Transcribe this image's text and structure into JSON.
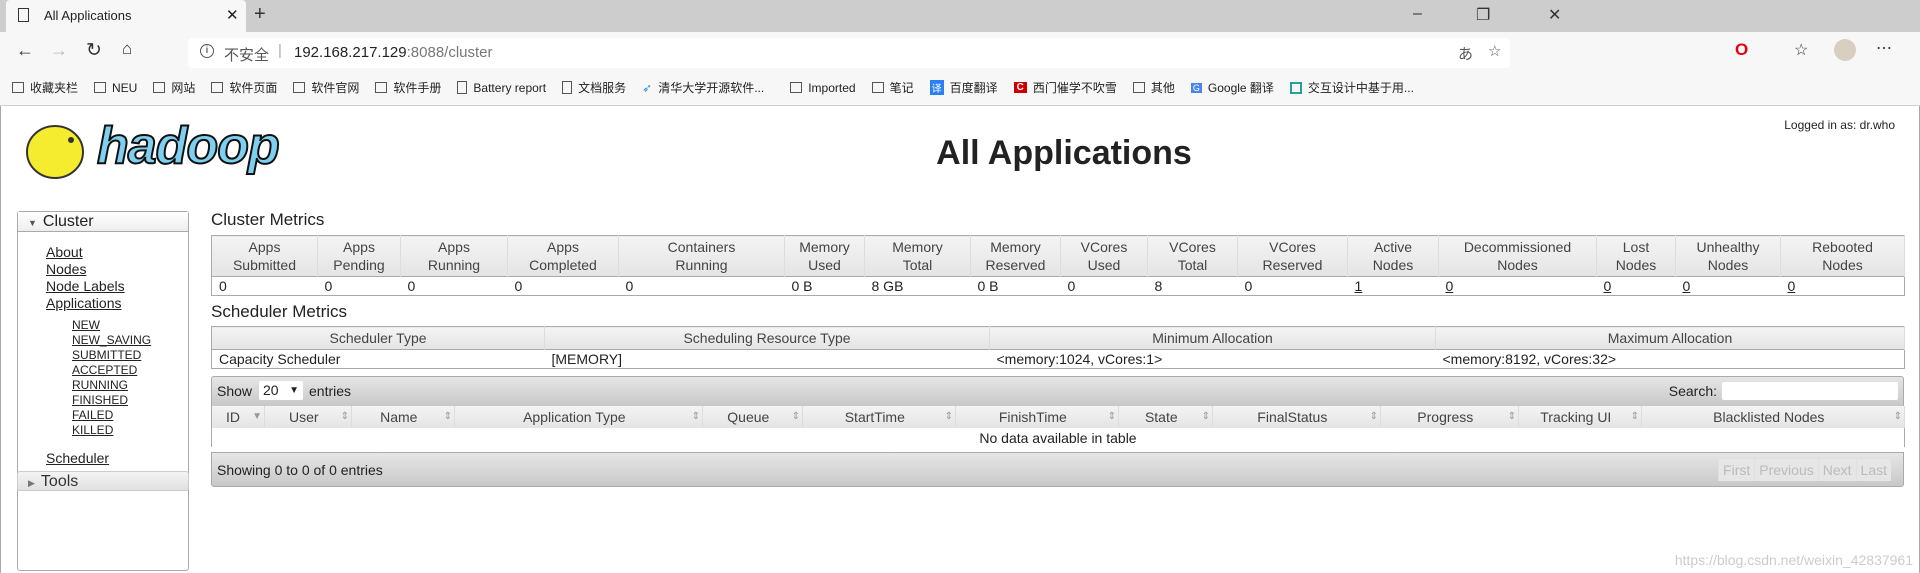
{
  "browser": {
    "tab_title": "All Applications",
    "security_label": "不安全",
    "url_host": "192.168.217.129",
    "url_rest": ":8088/cluster",
    "bookmarks": [
      "收藏夹栏",
      "NEU",
      "网站",
      "软件页面",
      "软件官网",
      "软件手册",
      "Battery report",
      "文档服务",
      "清华大学开源软件...",
      "Imported",
      "笔记",
      "百度翻译",
      "西门催学不吹雪",
      "其他",
      "Google 翻译",
      "交互设计中基于用..."
    ],
    "accent": "#e60012"
  },
  "header": {
    "logo_text": "hadoop",
    "title": "All Applications",
    "logged_in": "Logged in as: dr.who"
  },
  "sidebar": {
    "cluster_label": "Cluster",
    "links": [
      "About",
      "Nodes",
      "Node Labels",
      "Applications"
    ],
    "states": [
      "NEW",
      "NEW_SAVING",
      "SUBMITTED",
      "ACCEPTED",
      "RUNNING",
      "FINISHED",
      "FAILED",
      "KILLED"
    ],
    "scheduler": "Scheduler",
    "tools_label": "Tools"
  },
  "cluster_metrics": {
    "heading": "Cluster Metrics",
    "columns": [
      [
        "Apps",
        "Submitted"
      ],
      [
        "Apps",
        "Pending"
      ],
      [
        "Apps",
        "Running"
      ],
      [
        "Apps",
        "Completed"
      ],
      [
        "Containers",
        "Running"
      ],
      [
        "Memory",
        "Used"
      ],
      [
        "Memory",
        "Total"
      ],
      [
        "Memory",
        "Reserved"
      ],
      [
        "VCores",
        "Used"
      ],
      [
        "VCores",
        "Total"
      ],
      [
        "VCores",
        "Reserved"
      ],
      [
        "Active",
        "Nodes"
      ],
      [
        "Decommissioned",
        "Nodes"
      ],
      [
        "Lost",
        "Nodes"
      ],
      [
        "Unhealthy",
        "Nodes"
      ],
      [
        "Rebooted",
        "Nodes"
      ]
    ],
    "values": [
      "0",
      "0",
      "0",
      "0",
      "0",
      "0 B",
      "8 GB",
      "0 B",
      "0",
      "8",
      "0",
      "1",
      "0",
      "0",
      "0",
      "0"
    ]
  },
  "scheduler_metrics": {
    "heading": "Scheduler Metrics",
    "columns": [
      "Scheduler Type",
      "Scheduling Resource Type",
      "Minimum Allocation",
      "Maximum Allocation"
    ],
    "values": [
      "Capacity Scheduler",
      "[MEMORY]",
      "<memory:1024, vCores:1>",
      "<memory:8192, vCores:32>"
    ]
  },
  "apps_table": {
    "show_label": "Show",
    "entries_label": "entries",
    "page_size": "20",
    "search_label": "Search:",
    "search_value": "",
    "columns": [
      "ID",
      "User",
      "Name",
      "Application Type",
      "Queue",
      "StartTime",
      "FinishTime",
      "State",
      "FinalStatus",
      "Progress",
      "Tracking UI",
      "Blacklisted Nodes"
    ],
    "empty": "No data available in table",
    "info": "Showing 0 to 0 of 0 entries",
    "pager": [
      "First",
      "Previous",
      "Next",
      "Last"
    ]
  },
  "watermark": "https://blog.csdn.net/weixin_42837961"
}
